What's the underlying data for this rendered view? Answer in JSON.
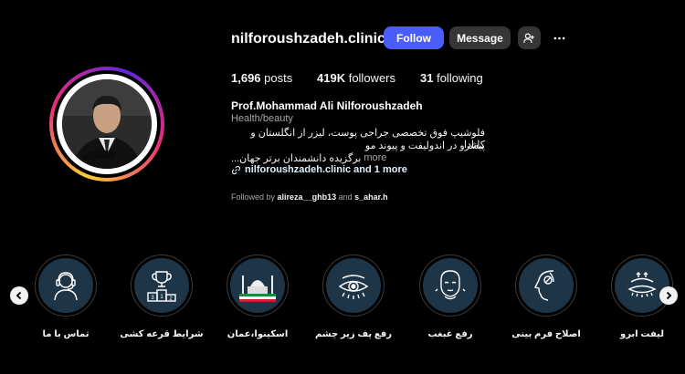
{
  "profile": {
    "username": "nilforoushzadeh.clinic",
    "follow_label": "Follow",
    "message_label": "Message",
    "posts_count": "1,696",
    "posts_label": "posts",
    "followers_count": "419K",
    "followers_label": "followers",
    "following_count": "31",
    "following_label": "following",
    "full_name": "Prof.Mohammad Ali Nilforoushzadeh",
    "category": "Health/beauty",
    "bio_line1": "فلوشیپ فوق تخصصی جراحی پوست، لیزر از انگلستان و کانادا",
    "bio_line2": "پیشرو در اندولیفت و پیوند مو",
    "bio_line3": "برگزیده دانشمندان برتر جهان...",
    "bio_more": "more",
    "link_text": "nilforoushzadeh.clinic and 1 more",
    "followed_by_prefix": "Followed by",
    "followed_by_user1": "alireza__ghb13",
    "followed_by_and": "and",
    "followed_by_user2": "s_ahar.h"
  },
  "highlights": [
    {
      "label": "تماس با ما",
      "icon": "woman-headset-icon"
    },
    {
      "label": "شرایط قرعه کشی",
      "icon": "trophy-podium-icon"
    },
    {
      "label": "اسکینوا،عمان",
      "icon": "mosque-skyline-icon"
    },
    {
      "label": "رفع پف زیر چشم",
      "icon": "eye-icon"
    },
    {
      "label": "رفع غبغب",
      "icon": "face-chin-icon"
    },
    {
      "label": "اصلاح فرم بینی",
      "icon": "nose-profile-icon"
    },
    {
      "label": "لیفت ابرو",
      "icon": "eyebrow-lift-icon"
    }
  ],
  "colors": {
    "follow_button": "#4a5df9",
    "secondary_button": "#363636",
    "highlight_fill": "#1e3548",
    "background": "#000000"
  }
}
